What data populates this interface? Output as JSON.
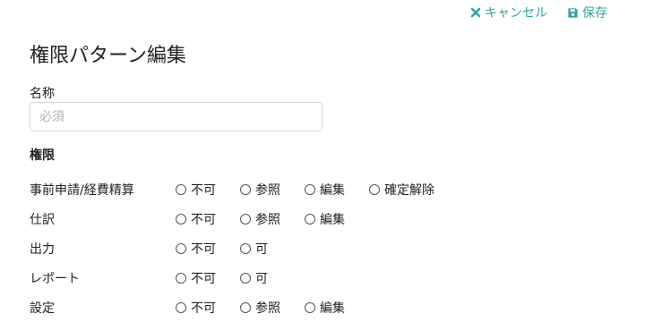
{
  "header": {
    "cancel_label": "キャンセル",
    "save_label": "保存",
    "accent_color": "#2aa5a5"
  },
  "page_title": "権限パターン編集",
  "name_field": {
    "label": "名称",
    "value": "",
    "placeholder": "必須"
  },
  "permissions": {
    "label": "権限",
    "rows": [
      {
        "name": "事前申請/経費精算",
        "options": [
          "不可",
          "参照",
          "編集",
          "確定解除"
        ]
      },
      {
        "name": "仕訳",
        "options": [
          "不可",
          "参照",
          "編集"
        ]
      },
      {
        "name": "出力",
        "options": [
          "不可",
          "可"
        ]
      },
      {
        "name": "レポート",
        "options": [
          "不可",
          "可"
        ]
      },
      {
        "name": "設定",
        "options": [
          "不可",
          "参照",
          "編集"
        ]
      }
    ]
  },
  "icons": {
    "cancel": "close-icon",
    "save": "floppy-disk-icon"
  }
}
